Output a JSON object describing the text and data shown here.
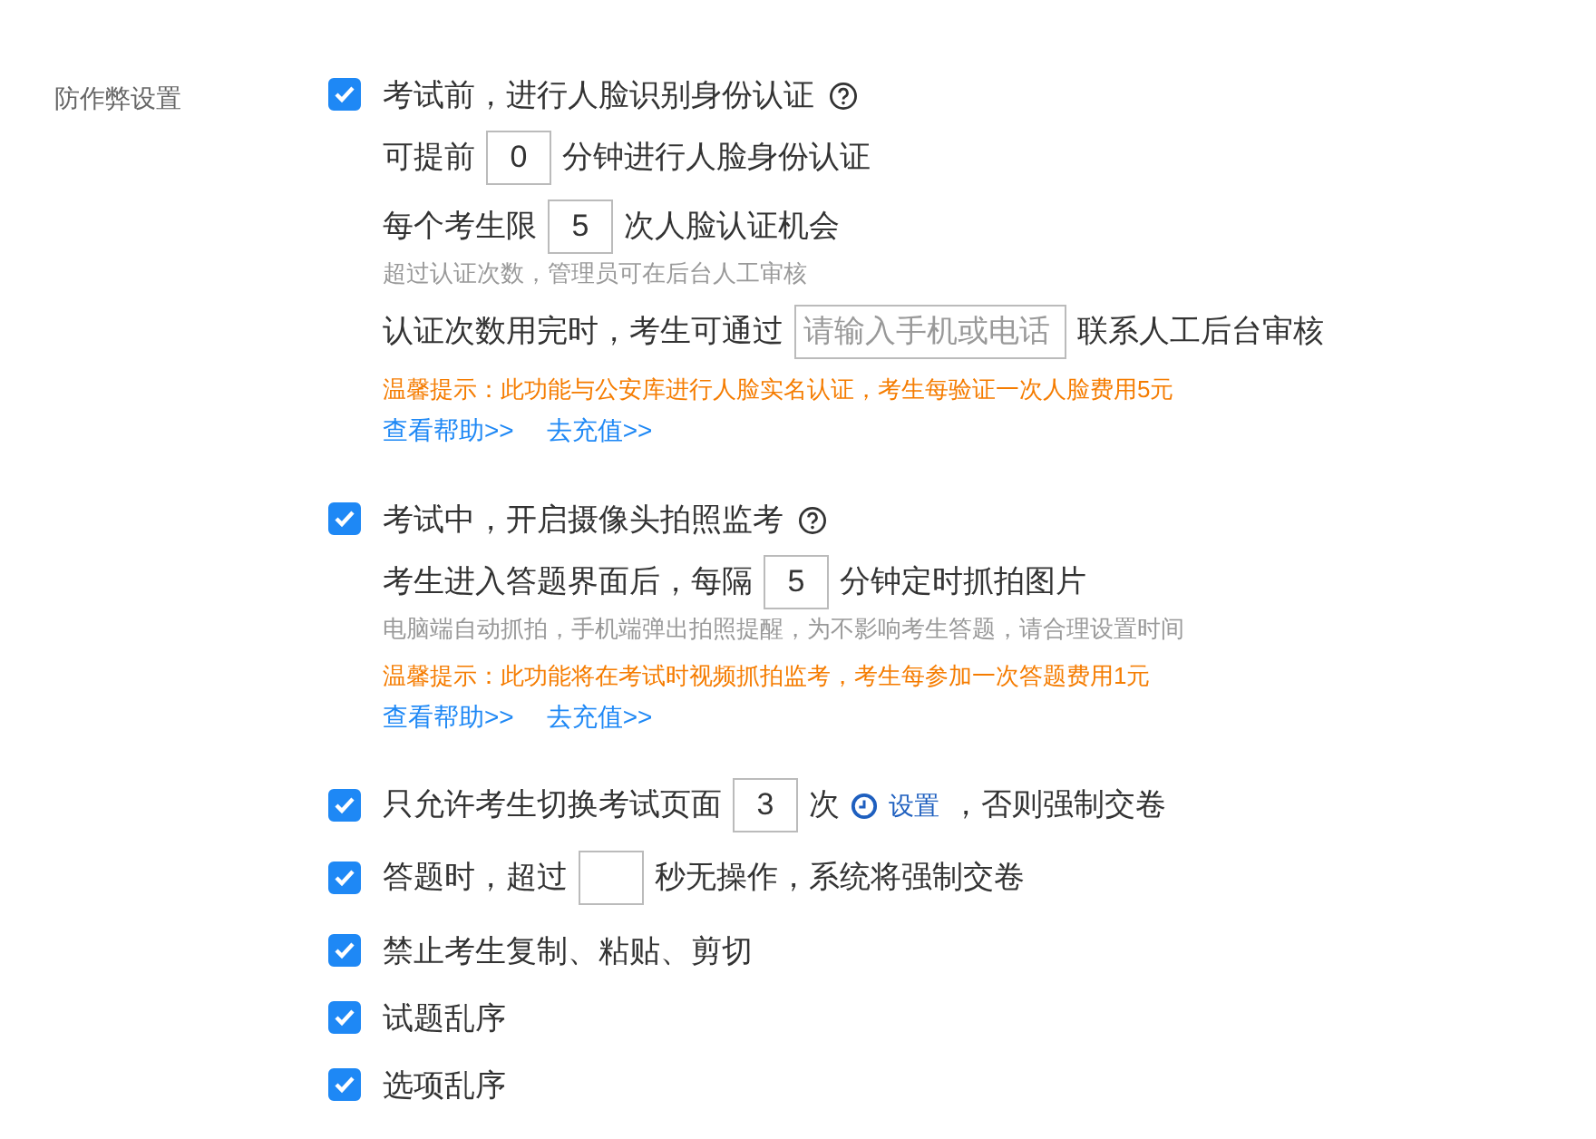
{
  "section_label": "防作弊设置",
  "options": [
    {
      "checked": true,
      "help": true,
      "parts": [
        {
          "kind": "text",
          "text": "考试前，进行人脸识别身份认证"
        }
      ],
      "lines": [
        {
          "kind": "row",
          "parts": [
            {
              "kind": "text",
              "text": "可提前"
            },
            {
              "kind": "input",
              "value": "0"
            },
            {
              "kind": "text",
              "text": "分钟进行人脸身份认证"
            }
          ]
        },
        {
          "kind": "row",
          "parts": [
            {
              "kind": "text",
              "text": "每个考生限"
            },
            {
              "kind": "input",
              "value": "5"
            },
            {
              "kind": "text",
              "text": "次人脸认证机会"
            }
          ]
        },
        {
          "kind": "hint",
          "text": "超过认证次数，管理员可在后台人工审核"
        },
        {
          "kind": "row",
          "parts": [
            {
              "kind": "text",
              "text": "认证次数用完时，考生可通过"
            },
            {
              "kind": "wide_input",
              "placeholder": "请输入手机或电话"
            },
            {
              "kind": "text",
              "text": "联系人工后台审核"
            }
          ]
        },
        {
          "kind": "warning",
          "text": "温馨提示：此功能与公安库进行人脸实名认证，考生每验证一次人脸费用5元"
        },
        {
          "kind": "links",
          "links": [
            "查看帮助>>",
            "去充值>>"
          ]
        }
      ]
    },
    {
      "checked": true,
      "help": true,
      "parts": [
        {
          "kind": "text",
          "text": "考试中，开启摄像头拍照监考"
        }
      ],
      "lines": [
        {
          "kind": "row",
          "parts": [
            {
              "kind": "text",
              "text": "考生进入答题界面后，每隔"
            },
            {
              "kind": "input",
              "value": "5"
            },
            {
              "kind": "text",
              "text": "分钟定时抓拍图片"
            }
          ]
        },
        {
          "kind": "hint",
          "text": "电脑端自动抓拍，手机端弹出拍照提醒，为不影响考生答题，请合理设置时间"
        },
        {
          "kind": "warning",
          "text": "温馨提示：此功能将在考试时视频抓拍监考，考生每参加一次答题费用1元"
        },
        {
          "kind": "links",
          "links": [
            "查看帮助>>",
            "去充值>>"
          ]
        }
      ]
    },
    {
      "checked": true,
      "help": false,
      "parts": [
        {
          "kind": "text",
          "text": "只允许考生切换考试页面"
        },
        {
          "kind": "input",
          "value": "3"
        },
        {
          "kind": "text",
          "text": "次"
        },
        {
          "kind": "setting",
          "text": "设置"
        },
        {
          "kind": "text",
          "text": "，否则强制交卷"
        }
      ]
    },
    {
      "checked": true,
      "help": false,
      "parts": [
        {
          "kind": "text",
          "text": "答题时，超过"
        },
        {
          "kind": "input"
        },
        {
          "kind": "text",
          "text": "秒无操作，系统将强制交卷"
        }
      ]
    },
    {
      "checked": true,
      "help": false,
      "parts": [
        {
          "kind": "text",
          "text": "禁止考生复制、粘贴、剪切"
        }
      ]
    },
    {
      "checked": true,
      "help": false,
      "parts": [
        {
          "kind": "text",
          "text": "试题乱序"
        }
      ]
    },
    {
      "checked": true,
      "help": false,
      "parts": [
        {
          "kind": "text",
          "text": "选项乱序"
        }
      ]
    }
  ]
}
